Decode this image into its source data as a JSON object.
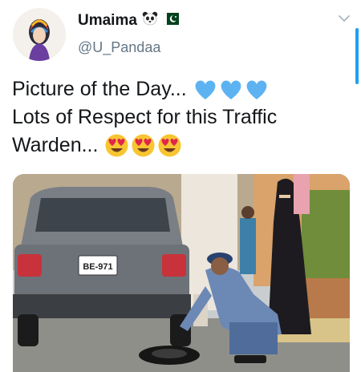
{
  "user": {
    "display_name": "Umaima",
    "handle": "@U_Pandaa",
    "badges": [
      "panda-emoji",
      "pakistan-flag-emoji"
    ]
  },
  "tweet": {
    "line1": "Picture of the Day...",
    "line2": "Lots of Respect for this Traffic",
    "line3": "Warden...",
    "line1_emojis": [
      "blue-heart",
      "blue-heart",
      "blue-heart"
    ],
    "line3_emojis": [
      "heart-eyes",
      "heart-eyes",
      "heart-eyes"
    ]
  },
  "photo": {
    "plate_text": "BE-971",
    "subject": "traffic-warden-changing-tire"
  },
  "colors": {
    "accent": "#1da1f2",
    "text": "#14171a",
    "secondary_text": "#657786",
    "heart_blue": "#5db3f2",
    "emoji_yellow": "#f7c531",
    "emoji_red": "#e0264b"
  }
}
